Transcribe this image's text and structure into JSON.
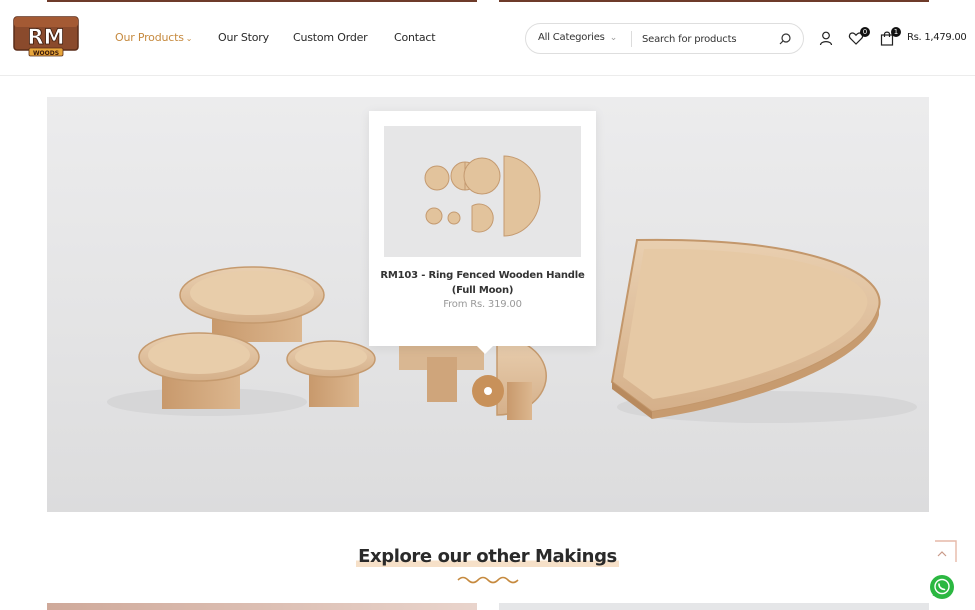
{
  "header": {
    "logo": {
      "text": "RM",
      "subtext": "WOODS"
    },
    "nav": [
      {
        "label": "Our Products",
        "active": true
      },
      {
        "label": "Our Story"
      },
      {
        "label": "Custom Order"
      },
      {
        "label": "Contact"
      }
    ],
    "search": {
      "category": "All Categories",
      "placeholder": "Search for products"
    },
    "wishlist_count": "0",
    "cart_count": "1",
    "cart_total": "Rs. 1,479.00"
  },
  "hero": {
    "popup": {
      "title": "RM103 - Ring Fenced Wooden Handle (Full Moon)",
      "price": "From Rs. 319.00"
    }
  },
  "section": {
    "title": "Explore our other Makings"
  },
  "colors": {
    "accent": "#c68a3f",
    "hotspot": "#c8915a",
    "brand_brown": "#6e3b2a"
  },
  "icons": [
    "user-icon",
    "heart-icon",
    "bag-icon",
    "search-icon",
    "chevron-down-icon",
    "arrow-up-icon",
    "whatsapp-icon"
  ]
}
